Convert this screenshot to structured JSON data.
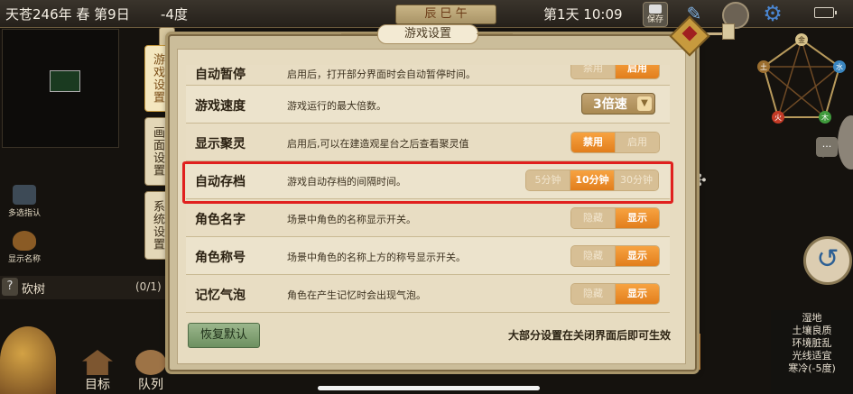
{
  "topbar": {
    "date": "天苍246年 春 第9日",
    "temperature": "-4度",
    "time_banner": "辰 巳 午",
    "day_time": "第1天 10:09",
    "save_label": "保存"
  },
  "left": {
    "multi_select": "多选指认",
    "show_names": "显示名称",
    "chop_help": "?",
    "chop_label": "砍树",
    "chop_count": "(0/1)",
    "goal_label": "目标",
    "squad_label": "队列"
  },
  "right": {
    "chat_label": "···",
    "env": [
      "湿地",
      "土壤良质",
      "环境脏乱",
      "光线适宜",
      "寒冷(-5度)"
    ],
    "wuxing": [
      "金",
      "水",
      "木",
      "火",
      "土"
    ]
  },
  "dialog": {
    "title": "游戏设置",
    "tabs": [
      "游戏设置",
      "画面设置",
      "系统设置"
    ],
    "rows": [
      {
        "name": "自动暂停",
        "desc": "启用后，打开部分界面时会自动暂停时间。",
        "options": [
          "禁用",
          "启用"
        ],
        "active": 1
      },
      {
        "name": "游戏速度",
        "desc": "游戏运行的最大倍数。",
        "select": "3倍速"
      },
      {
        "name": "显示聚灵",
        "desc": "启用后,可以在建造观星台之后查看聚灵值",
        "options": [
          "禁用",
          "启用"
        ],
        "active": 0
      },
      {
        "name": "自动存档",
        "desc": "游戏自动存档的间隔时间。",
        "options": [
          "5分钟",
          "10分钟",
          "30分钟"
        ],
        "active": 1
      },
      {
        "name": "角色名字",
        "desc": "场景中角色的名称显示开关。",
        "options": [
          "隐藏",
          "显示"
        ],
        "active": 1
      },
      {
        "name": "角色称号",
        "desc": "场景中角色的名称上方的称号显示开关。",
        "options": [
          "隐藏",
          "显示"
        ],
        "active": 1
      },
      {
        "name": "记忆气泡",
        "desc": "角色在产生记忆时会出现气泡。",
        "options": [
          "隐藏",
          "显示"
        ],
        "active": 1
      }
    ],
    "restore_label": "恢复默认",
    "footer_note": "大部分设置在关闭界面后即可生效"
  },
  "colors": {
    "accent": "#e8861f",
    "highlight": "#e0201e",
    "panel": "#e7dcc1"
  }
}
